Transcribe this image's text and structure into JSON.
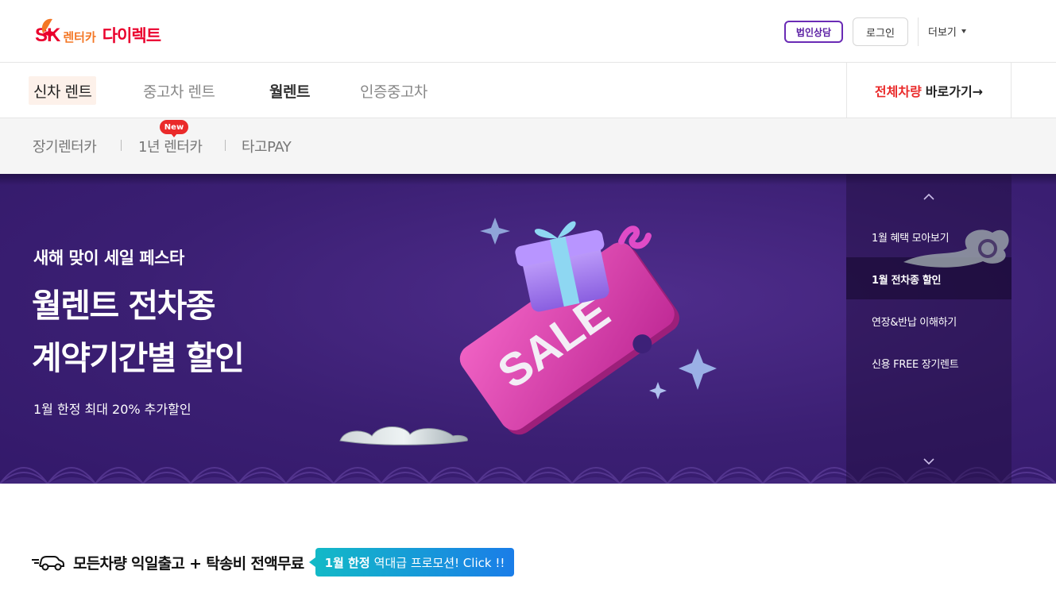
{
  "header": {
    "logo_sk": "SK",
    "logo_sub": "렌터카",
    "logo_main": "다이렉트",
    "corp_label": "법인상담",
    "login_label": "로그인",
    "more_label": "더보기"
  },
  "nav": {
    "items": [
      {
        "label": "신차 렌트"
      },
      {
        "label": "중고차 렌트"
      },
      {
        "label": "월렌트"
      },
      {
        "label": "인증중고차"
      }
    ],
    "all_red": "전체차량",
    "all_rest": "바로가기→"
  },
  "subnav": {
    "items": [
      {
        "label": "장기렌터카"
      },
      {
        "label": "1년 렌터카"
      },
      {
        "label": "타고PAY"
      }
    ],
    "new_badge": "New"
  },
  "banner": {
    "eyebrow": "새해 맞이 세일 페스타",
    "title_line1": "월렌트 전차종",
    "title_line2": "계약기간별 할인",
    "desc": "1월 한정 최대 20% 추가할인",
    "art_text": "SALE",
    "side_items": [
      {
        "label": "1월 혜택 모아보기"
      },
      {
        "label": "1월 전차종 할인"
      },
      {
        "label": "연장&반납 이해하기"
      },
      {
        "label": "신용 FREE 장기렌트"
      }
    ],
    "colors": {
      "bg": "#3b1f73",
      "ticket": "#d93aa8"
    }
  },
  "promo": {
    "text": "모든차량 익일출고 + 탁송비 전액무료",
    "pill_bold": "1월 한정",
    "pill_rest": "역대급 프로모션! Click !!"
  },
  "icons": {
    "up": "chevron-up-icon",
    "down": "chevron-down-icon",
    "car": "fast-car-icon",
    "caret": "caret-down-icon"
  }
}
